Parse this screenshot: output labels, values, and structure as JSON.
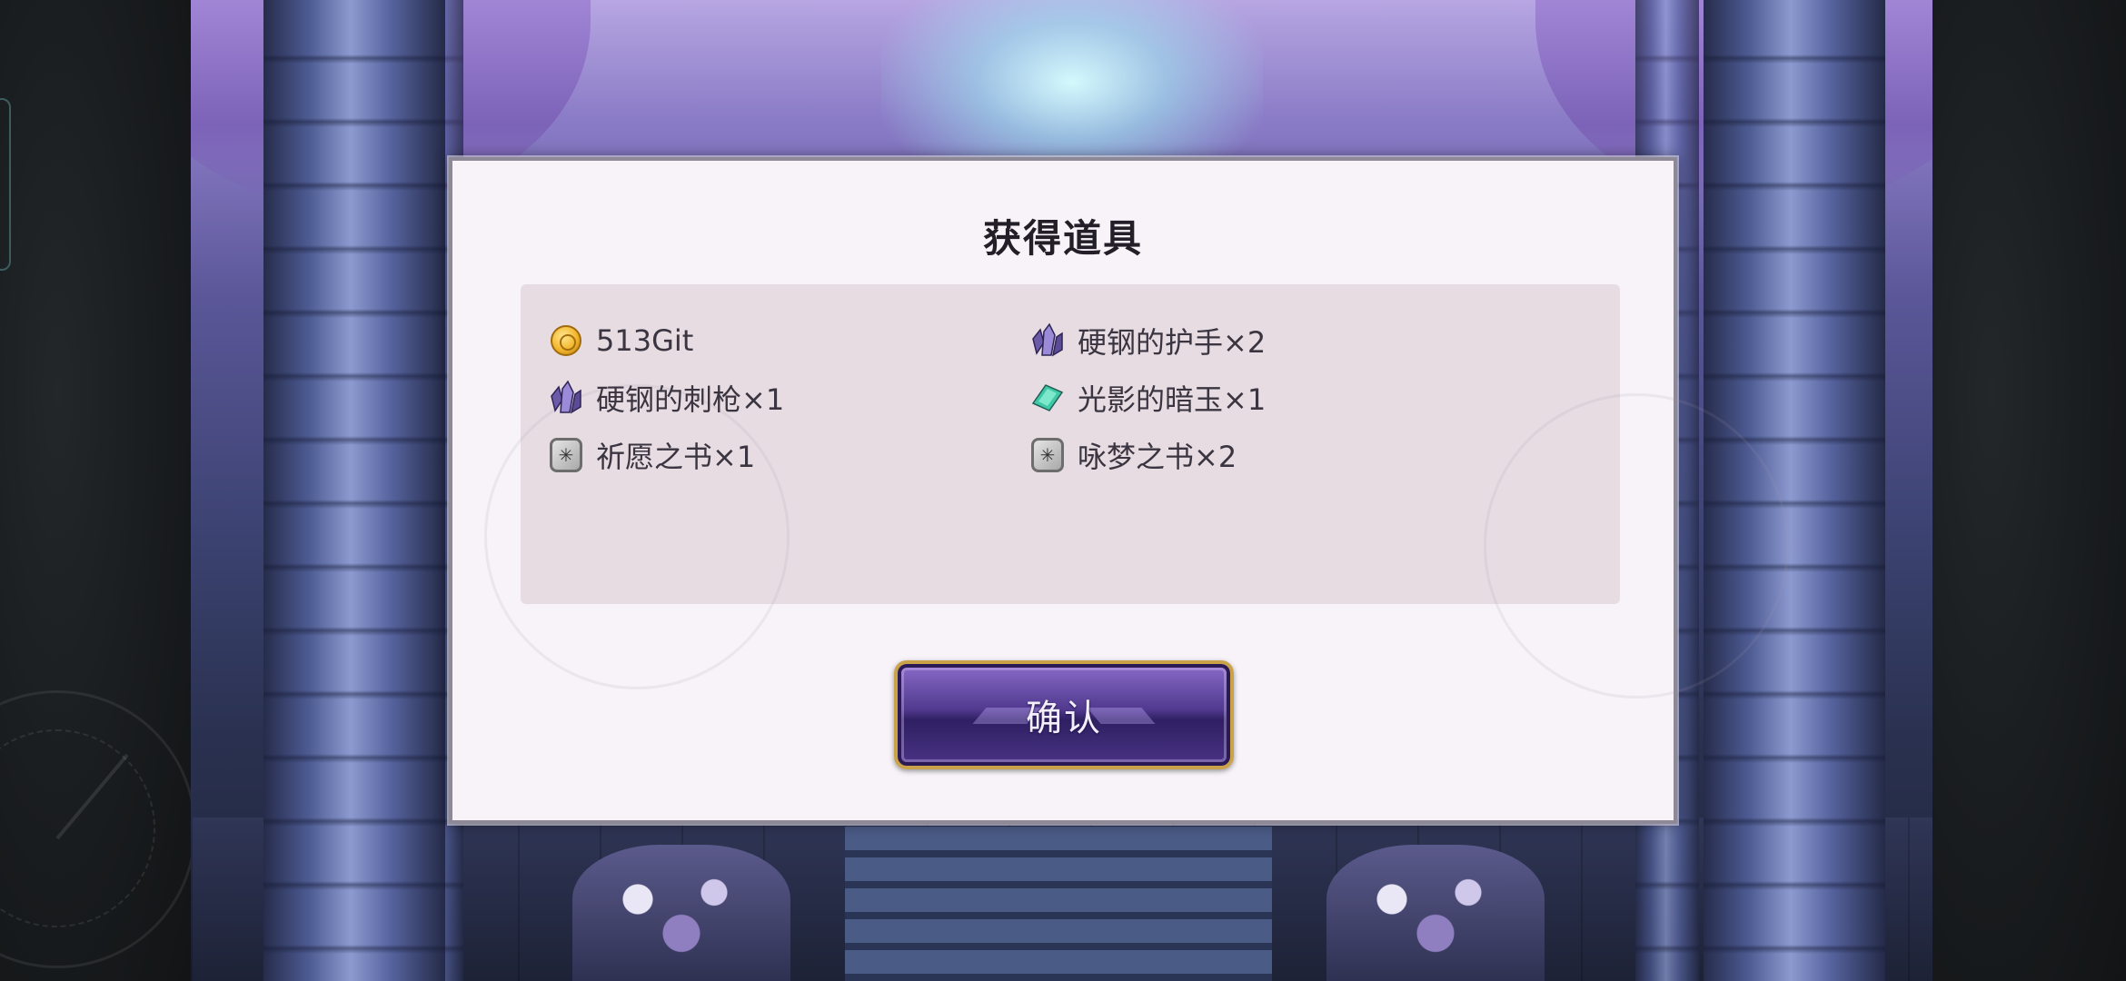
{
  "dialog": {
    "title": "获得道具",
    "confirm_label": "确认"
  },
  "items": [
    {
      "icon": "gold-coin-icon",
      "label": "513Git"
    },
    {
      "icon": "purple-crystal-icon",
      "label": "硬钢的护手×2"
    },
    {
      "icon": "purple-crystal-icon",
      "label": "硬钢的刺枪×1"
    },
    {
      "icon": "green-gem-icon",
      "label": "光影的暗玉×1"
    },
    {
      "icon": "book-icon",
      "label": "祈愿之书×1"
    },
    {
      "icon": "book-icon",
      "label": "咏梦之书×2"
    }
  ],
  "colors": {
    "dialog_bg": "#f7f3f8",
    "panel_bg": "#e6dce2",
    "button_border": "#c9a24a",
    "button_fill": "#50398e"
  }
}
